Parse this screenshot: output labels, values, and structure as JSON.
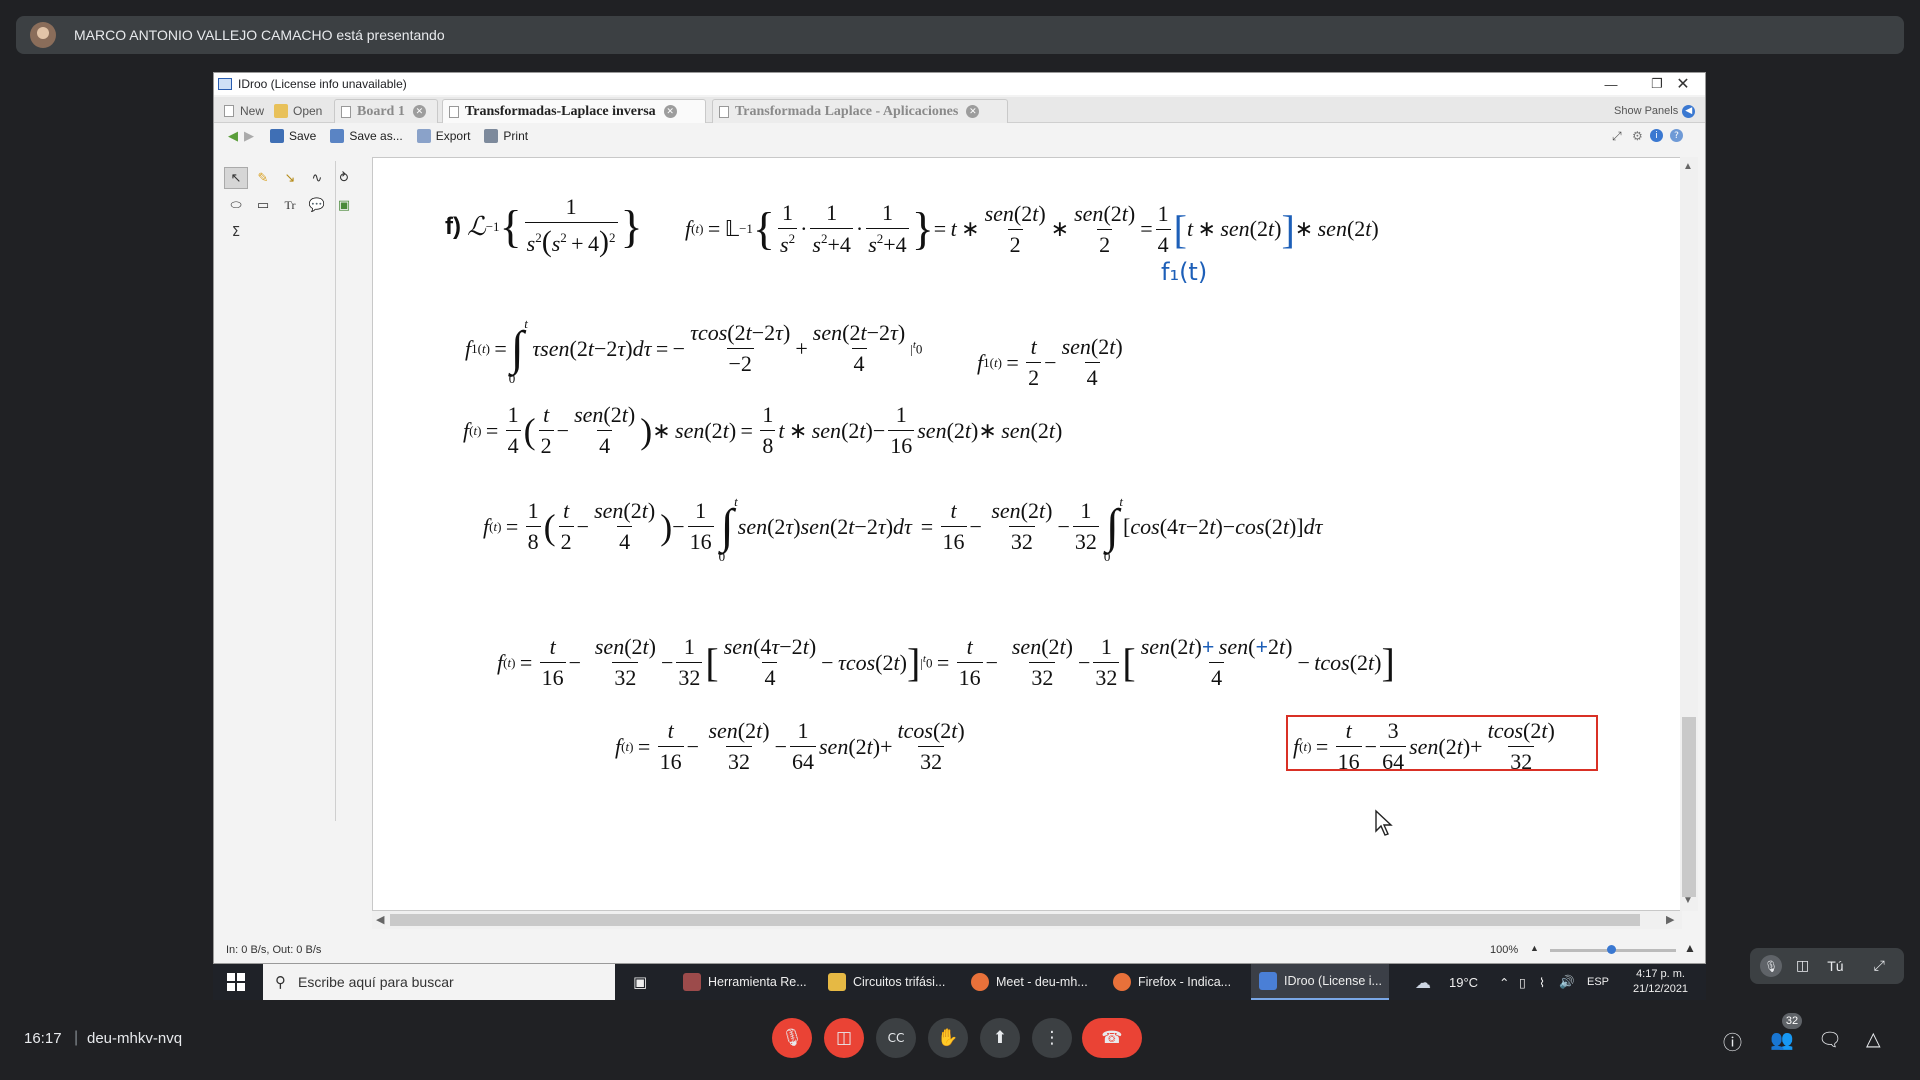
{
  "meet": {
    "presenter_banner": "MARCO ANTONIO VALLEJO CAMACHO está presentando",
    "time": "16:17",
    "meeting_code": "deu-mhkv-nvq",
    "participants_count": "32",
    "self_label": "Tú"
  },
  "window": {
    "title": "IDroo (License info unavailable)",
    "tabs": {
      "new": "New",
      "open": "Open",
      "doc1": "Board 1",
      "doc2": "Transformadas-Laplace inversa",
      "doc3": "Transformada Laplace - Aplicaciones"
    },
    "show_panels": "Show Panels",
    "toolbar": {
      "save": "Save",
      "save_as": "Save as...",
      "export": "Export",
      "print": "Print"
    },
    "status_left": "In: 0 B/s, Out: 0 B/s",
    "zoom": "100%"
  },
  "board": {
    "handwritten_note": "f₁(t)"
  },
  "taskbar": {
    "search_placeholder": "Escribe aquí para buscar",
    "apps": [
      "Herramienta Re...",
      "Circuitos trifási...",
      "Meet - deu-mh...",
      "Firefox - Indica...",
      "IDroo (License i..."
    ],
    "weather": "19°C",
    "lang": "ESP",
    "clock_time": "4:17 p. m.",
    "clock_date": "21/12/2021"
  },
  "colors": {
    "meet_bg": "#202124",
    "end_call": "#ea4335",
    "highlight_box": "#d93025",
    "ink": "#1d5fb8"
  }
}
